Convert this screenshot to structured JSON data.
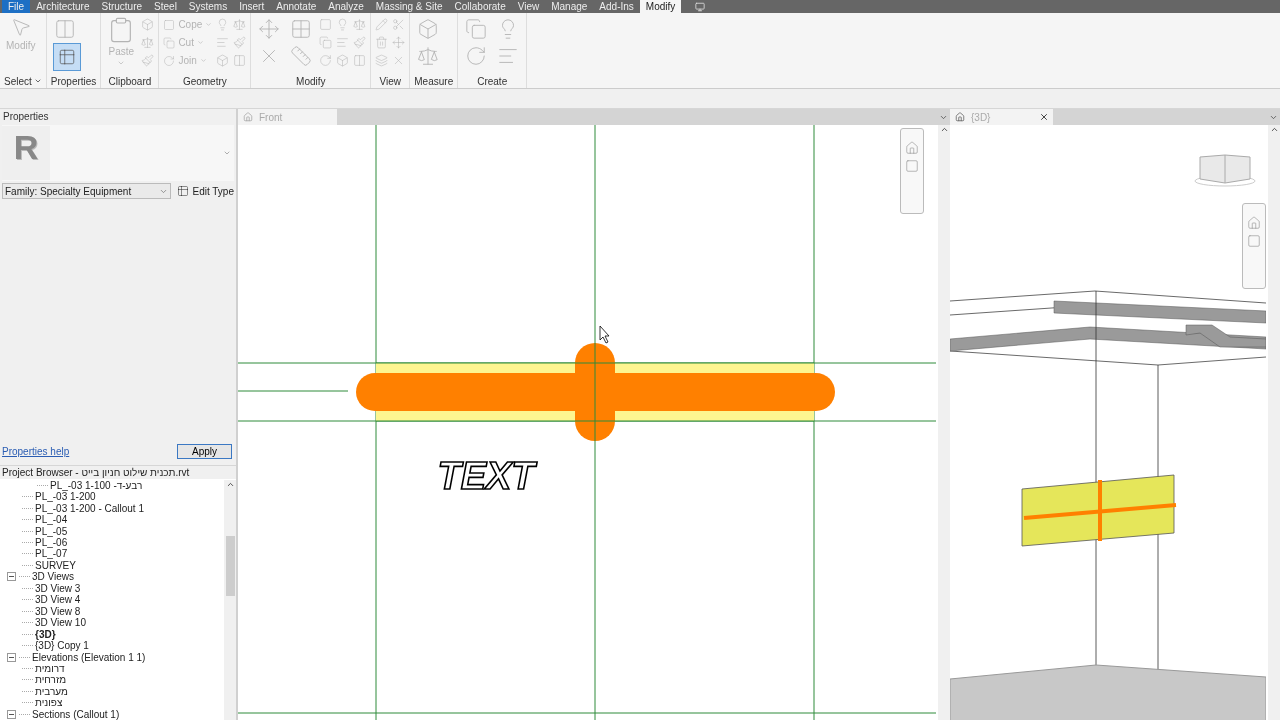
{
  "menu_tabs": [
    {
      "label": "File",
      "kind": "file",
      "selected": false
    },
    {
      "label": "Architecture",
      "kind": "tab",
      "selected": false
    },
    {
      "label": "Structure",
      "kind": "tab",
      "selected": false
    },
    {
      "label": "Steel",
      "kind": "tab",
      "selected": false
    },
    {
      "label": "Systems",
      "kind": "tab",
      "selected": false
    },
    {
      "label": "Insert",
      "kind": "tab",
      "selected": false
    },
    {
      "label": "Annotate",
      "kind": "tab",
      "selected": false
    },
    {
      "label": "Analyze",
      "kind": "tab",
      "selected": false
    },
    {
      "label": "Massing & Site",
      "kind": "tab",
      "selected": false
    },
    {
      "label": "Collaborate",
      "kind": "tab",
      "selected": false
    },
    {
      "label": "View",
      "kind": "tab",
      "selected": false
    },
    {
      "label": "Manage",
      "kind": "tab",
      "selected": false
    },
    {
      "label": "Add-Ins",
      "kind": "tab",
      "selected": false
    },
    {
      "label": "Modify",
      "kind": "tab",
      "selected": true
    }
  ],
  "ribbon": {
    "panels": [
      {
        "title": "Select",
        "menu": true,
        "tools": [
          {
            "kind": "large",
            "label": "Modify",
            "disabled": true
          }
        ]
      },
      {
        "title": "Properties",
        "tools": [
          {
            "kind": "stack",
            "disabled": true
          },
          {
            "kind": "toggle",
            "on": true
          }
        ]
      },
      {
        "title": "Clipboard",
        "tools": [
          {
            "kind": "large",
            "label": "Paste",
            "menu": true,
            "disabled": true
          },
          {
            "kind": "icon",
            "disabled": true
          },
          {
            "kind": "icon",
            "disabled": true
          },
          {
            "kind": "icon",
            "disabled": true
          }
        ]
      },
      {
        "title": "Geometry",
        "tools": [
          {
            "kind": "small",
            "label": "Cope",
            "menu": true,
            "disabled": true
          },
          {
            "kind": "small",
            "label": "Cut",
            "menu": true,
            "disabled": true
          },
          {
            "kind": "small",
            "label": "Join",
            "menu": true,
            "disabled": true
          },
          {
            "kind": "icon",
            "disabled": true
          },
          {
            "kind": "icon",
            "disabled": true
          },
          {
            "kind": "icon",
            "disabled": true
          },
          {
            "kind": "icon",
            "disabled": true
          },
          {
            "kind": "icon",
            "disabled": true
          },
          {
            "kind": "icon",
            "disabled": true
          }
        ]
      },
      {
        "title": "Modify",
        "tools": [
          {
            "kind": "stack",
            "disabled": true
          },
          {
            "kind": "stack",
            "disabled": true
          },
          {
            "kind": "stack",
            "disabled": true
          },
          {
            "kind": "stack",
            "disabled": true
          },
          {
            "kind": "icon",
            "disabled": true
          },
          {
            "kind": "icon",
            "disabled": true
          },
          {
            "kind": "icon",
            "disabled": true
          },
          {
            "kind": "icon",
            "disabled": true
          },
          {
            "kind": "icon",
            "disabled": true
          },
          {
            "kind": "icon",
            "disabled": true
          },
          {
            "kind": "icon",
            "disabled": true
          },
          {
            "kind": "icon",
            "disabled": true
          },
          {
            "kind": "icon",
            "disabled": true
          }
        ]
      },
      {
        "title": "View",
        "tools": [
          {
            "kind": "icon",
            "disabled": true
          },
          {
            "kind": "icon",
            "disabled": true
          },
          {
            "kind": "icon",
            "disabled": true
          },
          {
            "kind": "icon",
            "disabled": true
          },
          {
            "kind": "icon",
            "disabled": true
          },
          {
            "kind": "icon",
            "disabled": true
          }
        ]
      },
      {
        "title": "Measure",
        "tools": [
          {
            "kind": "stack",
            "disabled": true
          },
          {
            "kind": "stack",
            "disabled": true
          }
        ]
      },
      {
        "title": "Create",
        "tools": [
          {
            "kind": "stack",
            "disabled": true
          },
          {
            "kind": "stack",
            "disabled": true
          },
          {
            "kind": "stack",
            "disabled": true
          },
          {
            "kind": "stack",
            "disabled": true
          }
        ]
      }
    ]
  },
  "properties": {
    "title": "Properties",
    "logo": "R",
    "type_selector": "Family: Specialty Equipment",
    "edit_type": "Edit Type",
    "help_link": "Properties help",
    "apply": "Apply"
  },
  "project_browser": {
    "title": "Project Browser - תכנית שילוט חניון בייט.rvt",
    "tree": [
      {
        "children": [
          {
            "children": [
              {
                "label": "PL_-03 1-100 -רבע-ד",
                "selected": false
              }
            ]
          },
          {
            "label": "PL_-03 1-200",
            "selected": false
          },
          {
            "label": "PL_-03 1-200 - Callout 1",
            "selected": false
          },
          {
            "label": "PL_-04",
            "selected": false
          },
          {
            "label": "PL_-05",
            "selected": false
          },
          {
            "label": "PL_-06",
            "selected": false
          },
          {
            "label": "PL_-07",
            "selected": false
          },
          {
            "label": "SURVEY",
            "selected": false
          }
        ]
      },
      {
        "label": "3D Views",
        "expanded": true,
        "selected": false,
        "children": [
          {
            "label": "3D View 3",
            "selected": false
          },
          {
            "label": "3D View 4",
            "selected": false
          },
          {
            "label": "3D View 8",
            "selected": false
          },
          {
            "label": "3D View 10",
            "selected": false
          },
          {
            "label": "{3D}",
            "selected": true
          },
          {
            "label": "{3D} Copy 1",
            "selected": false
          }
        ]
      },
      {
        "label": "Elevations (Elevation 1 1)",
        "expanded": true,
        "selected": false,
        "children": [
          {
            "label": "דרומית",
            "selected": false
          },
          {
            "label": "מזרחית",
            "selected": false
          },
          {
            "label": "מערבית",
            "selected": false
          },
          {
            "label": "צפונית",
            "selected": false
          }
        ]
      },
      {
        "label": "Sections (Callout 1)",
        "expanded": true,
        "selected": false
      }
    ]
  },
  "front_view": {
    "tab": "Front",
    "annotation": "TEXT"
  },
  "view_3d": {
    "tab": "{3D}"
  }
}
